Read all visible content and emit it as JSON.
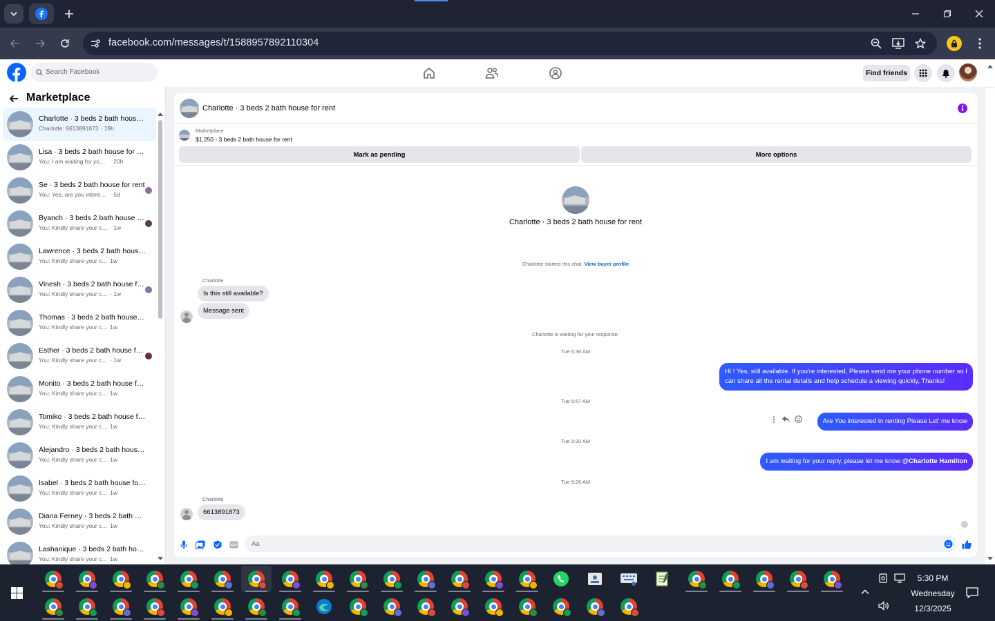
{
  "browser": {
    "url": "facebook.com/messages/t/1588957892110304"
  },
  "fb_header": {
    "search_placeholder": "Search Facebook",
    "find_friends_label": "Find friends"
  },
  "sidebar": {
    "title": "Marketplace",
    "conversations": [
      {
        "name": "Charlotte · 3 beds 2 bath house for rent",
        "snippet": "Charlotte: 6613891873",
        "time": "· 19h",
        "active": true
      },
      {
        "name": "Lisa · 3 beds 2 bath house for rent",
        "snippet": "You: I am waiting for your reply, ...",
        "time": "· 20h"
      },
      {
        "name": "Se · 3 beds 2 bath house for rent",
        "snippet": "You: Yes, are you interested?",
        "time": "· 5d"
      },
      {
        "name": "Byanch · 3 beds 2 bath house for rent",
        "snippet": "You: Kindly share your contact ...",
        "time": "· 1w"
      },
      {
        "name": "Lawrence · 3 beds 2 bath house for rent",
        "snippet": "You: Kindly share your contact nu...",
        "time": "1w"
      },
      {
        "name": "Vinesh · 3 beds 2 bath house for rent",
        "snippet": "You: Kindly share your contact ...",
        "time": "· 1w"
      },
      {
        "name": "Thomas · 3 beds 2 bath house for rent",
        "snippet": "You: Kindly share your contact nu...",
        "time": "1w"
      },
      {
        "name": "Esther · 3 beds 2 bath house for rent",
        "snippet": "You: Kindly share your contact ...",
        "time": "· 1w"
      },
      {
        "name": "Monito · 3 beds 2 bath house for rent",
        "snippet": "You: Kindly share your contact nu...",
        "time": "1w"
      },
      {
        "name": "Tomiko · 3 beds 2 bath house for rent",
        "snippet": "You: Kindly share your contact nu...",
        "time": "1w"
      },
      {
        "name": "Alejandro · 3 beds 2 bath house for rent",
        "snippet": "You: Kindly share your contact nu...",
        "time": "1w"
      },
      {
        "name": "Isabel · 3 beds 2 bath house for rent",
        "snippet": "You: Kindly share your contact nu...",
        "time": "1w"
      },
      {
        "name": "Diana Ferney · 3 beds 2 bath house for rent",
        "snippet": "You: Kindly share your contact nu...",
        "time": "1w"
      },
      {
        "name": "Lashanique · 3 beds 2 bath house for rent",
        "snippet": "You: Kindly share your contact nu...",
        "time": "1w"
      }
    ]
  },
  "chat": {
    "title": "Charlotte · 3 beds 2 bath house for rent",
    "listing_label": "Marketplace",
    "listing_desc": "$1,250 - 3 beds 2 bath house for rent",
    "btn_pending": "Mark as pending",
    "btn_more": "More options",
    "intro_name": "Charlotte · 3 beds 2 bath house for rent",
    "started_text": "Charlotte started this chat.",
    "buyer_profile_link": "View buyer profile",
    "sender_name": "Charlotte",
    "msg_available": "Is this still available?",
    "msg_sent": "Message sent",
    "waiting_text": "Charlotte is waiting for your response.",
    "ts1": "Tue 6:36 AM",
    "out1_line1": "Hi ! Yes, still available. If you're interested, Please send me your phone number so I",
    "out1_line2": "can share all the rental details and help schedule a viewing quickly, Thanks!",
    "ts2": "Tue 6:57 AM",
    "out2": "Are You  interested in renting Please Let' me know",
    "ts3": "Tue 8:20 AM",
    "out3_text": "I am waiting for your reply, please let me know ",
    "out3_mention": "@Charlotte Hamilton",
    "ts4": "Tue 9:26 AM",
    "sender_name2": "Charlotte",
    "msg_phone": "6613891873",
    "composer_placeholder": "Aa"
  },
  "taskbar": {
    "time": "5:30 PM",
    "day": "Wednesday",
    "date": "12/3/2025"
  }
}
